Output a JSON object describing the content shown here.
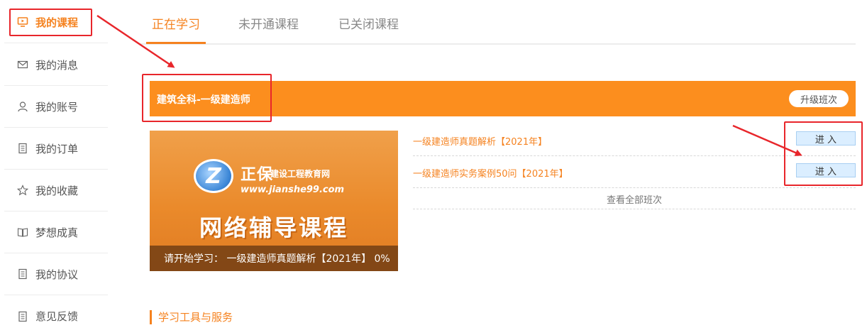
{
  "sidebar": {
    "items": [
      {
        "label": "我的课程",
        "icon": "monitor-icon",
        "active": true
      },
      {
        "label": "我的消息",
        "icon": "mail-icon"
      },
      {
        "label": "我的账号",
        "icon": "user-icon"
      },
      {
        "label": "我的订单",
        "icon": "document-icon"
      },
      {
        "label": "我的收藏",
        "icon": "star-icon"
      },
      {
        "label": "梦想成真",
        "icon": "book-icon"
      },
      {
        "label": "我的协议",
        "icon": "document-icon"
      },
      {
        "label": "意见反馈",
        "icon": "document-icon"
      }
    ]
  },
  "tabs": [
    {
      "label": "正在学习",
      "active": true
    },
    {
      "label": "未开通课程"
    },
    {
      "label": "已关闭课程"
    }
  ],
  "course": {
    "title": "建筑全科-一级建造师",
    "upgrade_label": "升级班次",
    "image": {
      "logo_letter": "Z",
      "logo_brand": "正保",
      "logo_sub": "建设工程教育网",
      "logo_url": "www.jianshe99.com",
      "headline": "网络辅导课程",
      "footer": "请开始学习：  一级建造师真题解析【2021年】 0%"
    },
    "classes": [
      {
        "name": "一级建造师真题解析【2021年】",
        "button": "进 入"
      },
      {
        "name": "一级建造师实务案例50问【2021年】",
        "button": "进 入"
      }
    ],
    "view_all": "查看全部班次"
  },
  "section": {
    "title": "学习工具与服务"
  },
  "colors": {
    "accent": "#f5821f",
    "banner": "#fc8e1e",
    "annotation": "#e8262b"
  }
}
